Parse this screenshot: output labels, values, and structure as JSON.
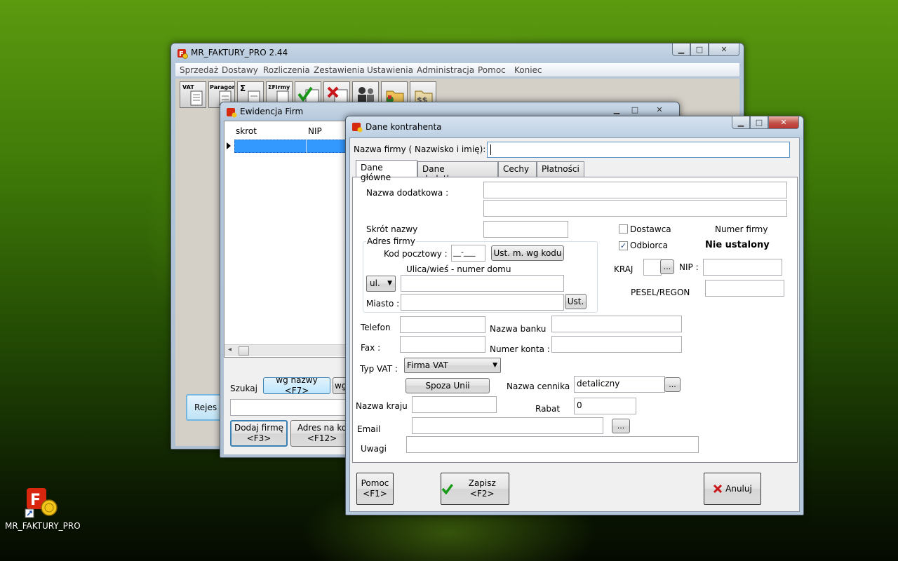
{
  "desktop": {
    "icon_label": "MR_FAKTURY_PRO"
  },
  "main_window": {
    "title": "MR_FAKTURY_PRO 2.44",
    "menu": [
      "Sprzedaż",
      "Dostawy",
      "Rozliczenia",
      "Zestawienia",
      "Ustawienia",
      "Administracja",
      "Pomoc",
      "Koniec"
    ],
    "toolbar": [
      {
        "label": "VAT",
        "icon": "invoice-vat-icon"
      },
      {
        "label": "Paragon",
        "icon": "receipt-icon"
      },
      {
        "label": "Σ",
        "icon": "sum-documents-icon"
      },
      {
        "label": "ΣFirmy",
        "icon": "sum-firms-icon"
      },
      {
        "label": "",
        "icon": "checkmark-list-icon"
      },
      {
        "label": "",
        "icon": "cancel-list-icon"
      },
      {
        "label": "",
        "icon": "people-icon"
      },
      {
        "label": "",
        "icon": "folder-chart-icon"
      },
      {
        "label": "",
        "icon": "folder-money-icon"
      }
    ],
    "register_button": "Rejes"
  },
  "firms_window": {
    "title": "Ewidencja Firm",
    "columns": [
      "skrot",
      "NIP"
    ],
    "search_label": "Szukaj",
    "search_by_name": "wg nazwy <F7>",
    "search_by_other": "wg",
    "add_firm_button": "Dodaj firmę\n<F3>",
    "address_button": "Adres na ko\n<F12>"
  },
  "contractor_dialog": {
    "title": "Dane kontrahenta",
    "name_label": "Nazwa firmy ( Nazwisko i imię):",
    "name_value": "",
    "tabs": [
      "Dane główne",
      "Dane dodatkowe",
      "Cechy",
      "Płatności"
    ],
    "active_tab": 0,
    "extra_name_label": "Nazwa dodatkowa :",
    "short_name_label": "Skrót nazwy",
    "supplier_label": "Dostawca",
    "supplier_checked": false,
    "recipient_label": "Odbiorca",
    "recipient_checked": true,
    "firm_number_label": "Numer firmy",
    "firm_number_value": "Nie ustalony",
    "address_group_label": "Adres firmy",
    "postal_code_label": "Kod pocztowy :",
    "postal_code_value": "__-___",
    "postal_lookup_button": "Ust. m. wg kodu",
    "street_label": "Ulica/wieś - numer domu",
    "street_prefix": "ul.",
    "city_label": "Miasto :",
    "city_button": "Ust.",
    "country_label": "KRAJ",
    "country_button": "...",
    "nip_label": "NIP :",
    "pesel_label": "PESEL/REGON",
    "phone_label": "Telefon",
    "fax_label": "Fax :",
    "bank_label": "Nazwa banku",
    "account_label": "Numer konta :",
    "vat_type_label": "Typ VAT :",
    "vat_type_value": "Firma VAT",
    "outside_eu_button": "Spoza Unii",
    "country_name_label": "Nazwa kraju",
    "price_list_label": "Nazwa cennika",
    "price_list_value": "detaliczny",
    "price_list_button": "...",
    "discount_label": "Rabat",
    "discount_value": "0",
    "email_label": "Email",
    "email_button": "...",
    "notes_label": "Uwagi",
    "help_button": "Pomoc\n<F1>",
    "save_button": "Zapisz <F2>",
    "cancel_button": "Anuluj"
  }
}
